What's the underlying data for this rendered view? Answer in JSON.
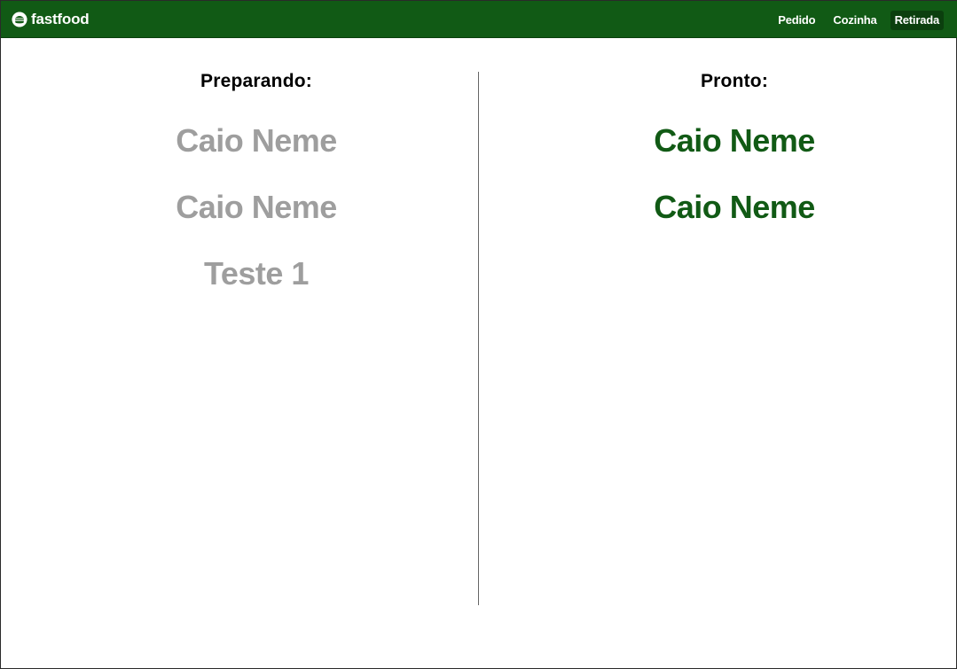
{
  "brand": {
    "name": "fastfood",
    "icon": "burger-icon"
  },
  "nav": {
    "items": [
      {
        "label": "Pedido",
        "active": false
      },
      {
        "label": "Cozinha",
        "active": false
      },
      {
        "label": "Retirada",
        "active": true
      }
    ]
  },
  "preparing": {
    "title": "Preparando:",
    "orders": [
      "Caio Neme",
      "Caio Neme",
      "Teste 1"
    ]
  },
  "ready": {
    "title": "Pronto:",
    "orders": [
      "Caio Neme",
      "Caio Neme"
    ]
  },
  "colors": {
    "navbar": "#115a15",
    "active_nav": "#0b3f0e",
    "preparing_text": "#9e9e9e",
    "ready_text": "#115a15"
  }
}
